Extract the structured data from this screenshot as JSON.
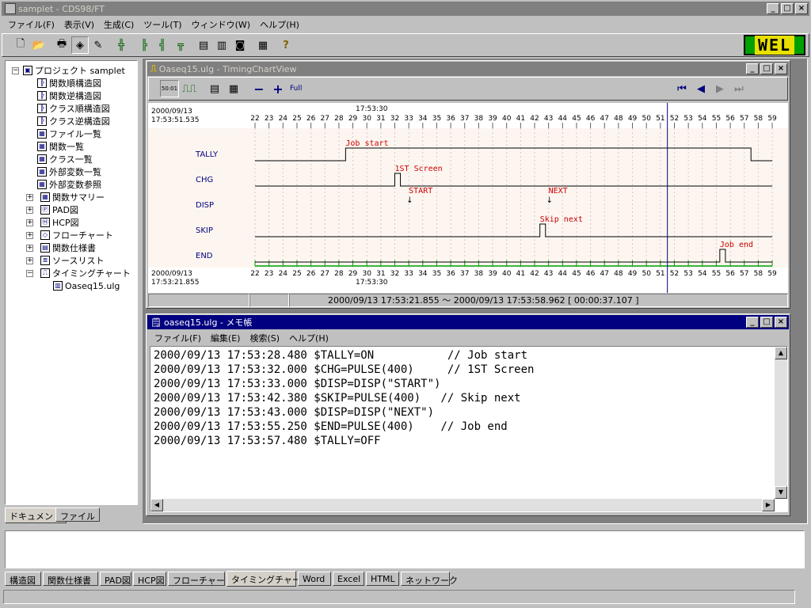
{
  "app": {
    "title": "samplet - CDS98/FT"
  },
  "menu": [
    "ファイル(F)",
    "表示(V)",
    "生成(C)",
    "ツール(T)",
    "ウィンドウ(W)",
    "ヘルプ(H)"
  ],
  "logo": "WEL",
  "tree": {
    "root": "プロジェクト samplet",
    "items": [
      {
        "label": "関数順構造図",
        "icon": "struct-icon"
      },
      {
        "label": "関数逆構造図",
        "icon": "struct-icon"
      },
      {
        "label": "クラス順構造図",
        "icon": "struct-icon"
      },
      {
        "label": "クラス逆構造図",
        "icon": "struct-icon"
      },
      {
        "label": "ファイル一覧",
        "icon": "list-icon"
      },
      {
        "label": "関数一覧",
        "icon": "list-icon"
      },
      {
        "label": "クラス一覧",
        "icon": "list-icon"
      },
      {
        "label": "外部変数一覧",
        "icon": "list-icon"
      },
      {
        "label": "外部変数参照",
        "icon": "list-icon"
      },
      {
        "label": "関数サマリー",
        "icon": "list-icon"
      },
      {
        "label": "PAD図",
        "icon": "pad-icon"
      },
      {
        "label": "HCP図",
        "icon": "hcp-icon"
      },
      {
        "label": "フローチャート",
        "icon": "flow-icon"
      },
      {
        "label": "関数仕様書",
        "icon": "doc-icon"
      },
      {
        "label": "ソースリスト",
        "icon": "source-icon"
      },
      {
        "label": "タイミングチャート",
        "icon": "timing-icon"
      }
    ],
    "child": "Oaseq15.ulg"
  },
  "left_tabs": [
    "ドキュメント",
    "ファイル"
  ],
  "timing_window": {
    "title": "Oaseq15.ulg - TimingChartView",
    "full_label": "Full",
    "top_date": "2000/09/13",
    "top_time": "17:53:51.535",
    "mid_time": "17:53:30",
    "bottom_date": "2000/09/13",
    "bottom_time": "17:53:21.855",
    "status": "2000/09/13 17:53:21.855 ～ 2000/09/13 17:53:58.962  [ 00:00:37.107 ]"
  },
  "chart_data": {
    "type": "timing",
    "x_ticks": [
      22,
      23,
      24,
      25,
      26,
      27,
      28,
      29,
      30,
      31,
      32,
      33,
      34,
      35,
      36,
      37,
      38,
      39,
      40,
      41,
      42,
      43,
      44,
      45,
      46,
      47,
      48,
      49,
      50,
      51,
      52,
      53,
      54,
      55,
      56,
      57,
      58,
      59
    ],
    "cursor_x": 51.5,
    "signals": [
      {
        "name": "TALLY",
        "type": "level",
        "high": [
          [
            28.48,
            57.48
          ]
        ],
        "labels": [
          {
            "x": 28.48,
            "text": "Job start"
          }
        ]
      },
      {
        "name": "CHG",
        "type": "pulse",
        "high": [
          [
            32.0,
            32.4
          ]
        ],
        "labels": [
          {
            "x": 32.0,
            "text": "1ST Screen"
          }
        ]
      },
      {
        "name": "DISP",
        "type": "event",
        "events": [
          {
            "x": 33.0,
            "text": "START"
          },
          {
            "x": 43.0,
            "text": "NEXT"
          }
        ]
      },
      {
        "name": "SKIP",
        "type": "pulse",
        "high": [
          [
            42.38,
            42.78
          ]
        ],
        "labels": [
          {
            "x": 42.38,
            "text": "Skip next"
          }
        ]
      },
      {
        "name": "END",
        "type": "pulse",
        "high": [
          [
            55.25,
            55.65
          ]
        ],
        "labels": [
          {
            "x": 55.25,
            "text": "Job end"
          }
        ]
      }
    ]
  },
  "notepad": {
    "title": "oaseq15.ulg - メモ帳",
    "menu": [
      "ファイル(F)",
      "編集(E)",
      "検索(S)",
      "ヘルプ(H)"
    ],
    "lines": [
      "2000/09/13 17:53:28.480 $TALLY=ON           // Job start",
      "2000/09/13 17:53:32.000 $CHG=PULSE(400)     // 1ST Screen",
      "2000/09/13 17:53:33.000 $DISP=DISP(\"START\")",
      "2000/09/13 17:53:42.380 $SKIP=PULSE(400)   // Skip next",
      "2000/09/13 17:53:43.000 $DISP=DISP(\"NEXT\")",
      "2000/09/13 17:53:55.250 $END=PULSE(400)    // Job end",
      "2000/09/13 17:53:57.480 $TALLY=OFF"
    ]
  },
  "bottom_tabs": [
    "構造図",
    "関数仕様書",
    "PAD図",
    "HCP図",
    "フローチャート",
    "タイミングチャート",
    "Word",
    "Excel",
    "HTML",
    "ネットワーク"
  ],
  "colors": {
    "title_inactive": "#808080",
    "chart_bg": "#fdf6f0",
    "signal_label": "#000080",
    "annotation": "#cc0000",
    "cursor": "#000080",
    "grid_green": "#00a000"
  }
}
